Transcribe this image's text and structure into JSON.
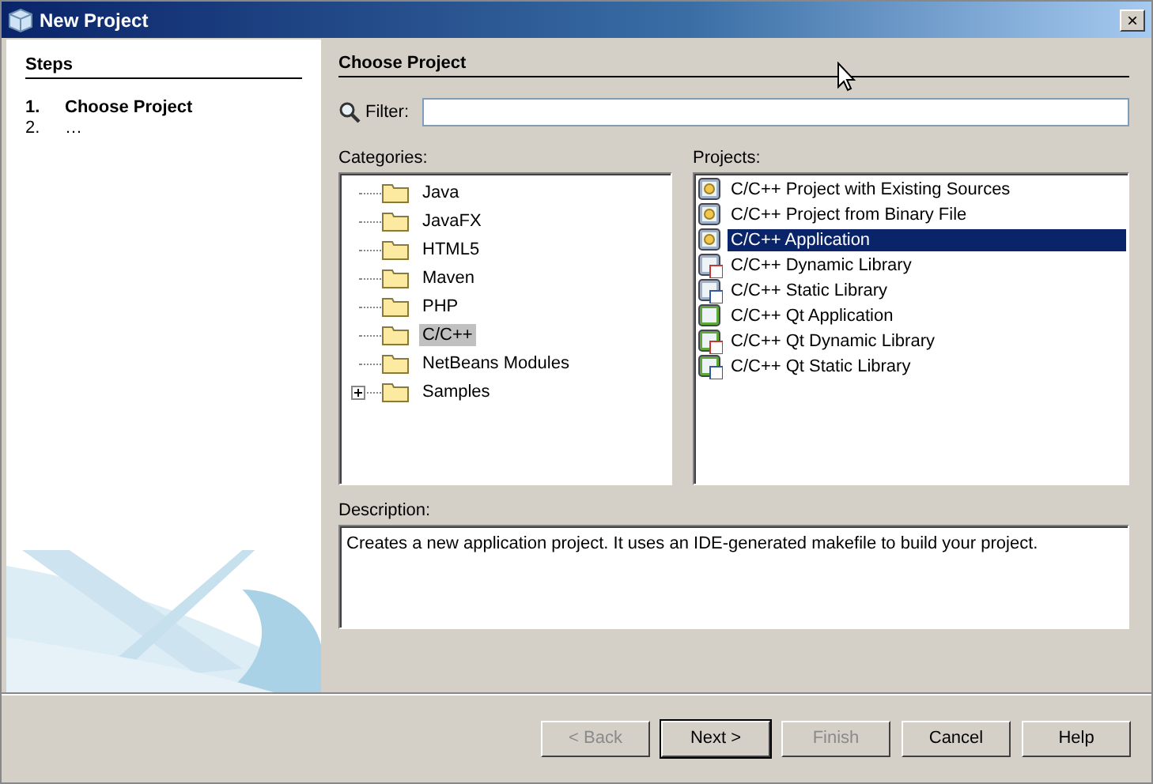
{
  "window": {
    "title": "New Project",
    "close": "×"
  },
  "steps": {
    "heading": "Steps",
    "items": [
      {
        "number": "1.",
        "label": "Choose Project",
        "selected": true
      },
      {
        "number": "2.",
        "label": "…",
        "selected": false
      }
    ]
  },
  "panel": {
    "heading": "Choose Project"
  },
  "filter": {
    "label": "Filter:"
  },
  "categories": {
    "label": "Categories:",
    "items": [
      {
        "label": "Java",
        "selected": false,
        "expandable": false
      },
      {
        "label": "JavaFX",
        "selected": false,
        "expandable": false
      },
      {
        "label": "HTML5",
        "selected": false,
        "expandable": false
      },
      {
        "label": "Maven",
        "selected": false,
        "expandable": false
      },
      {
        "label": "PHP",
        "selected": false,
        "expandable": false
      },
      {
        "label": "C/C++",
        "selected": true,
        "expandable": false
      },
      {
        "label": "NetBeans Modules",
        "selected": false,
        "expandable": false
      },
      {
        "label": "Samples",
        "selected": false,
        "expandable": true
      }
    ]
  },
  "projects": {
    "label": "Projects:",
    "items": [
      {
        "label": "C/C++ Project with Existing Sources",
        "kind": "sources",
        "selected": false
      },
      {
        "label": "C/C++ Project from Binary File",
        "kind": "sources",
        "selected": false
      },
      {
        "label": "C/C++ Application",
        "kind": "application",
        "selected": true
      },
      {
        "label": "C/C++ Dynamic Library",
        "kind": "dynamic",
        "selected": false
      },
      {
        "label": "C/C++ Static Library",
        "kind": "static",
        "selected": false
      },
      {
        "label": "C/C++ Qt Application",
        "kind": "qt-application",
        "selected": false
      },
      {
        "label": "C/C++ Qt Dynamic Library",
        "kind": "qt-dynamic",
        "selected": false
      },
      {
        "label": "C/C++ Qt Static Library",
        "kind": "qt-static",
        "selected": false
      }
    ]
  },
  "description": {
    "label": "Description:",
    "text": "Creates a new application project. It uses an IDE-generated makefile to build your project."
  },
  "buttons": [
    {
      "label": "< Back",
      "disabled": true,
      "default": false
    },
    {
      "label": "Next >",
      "disabled": false,
      "default": true
    },
    {
      "label": "Finish",
      "disabled": true,
      "default": false
    },
    {
      "label": "Cancel",
      "disabled": false,
      "default": false
    },
    {
      "label": "Help",
      "disabled": false,
      "default": false
    }
  ]
}
